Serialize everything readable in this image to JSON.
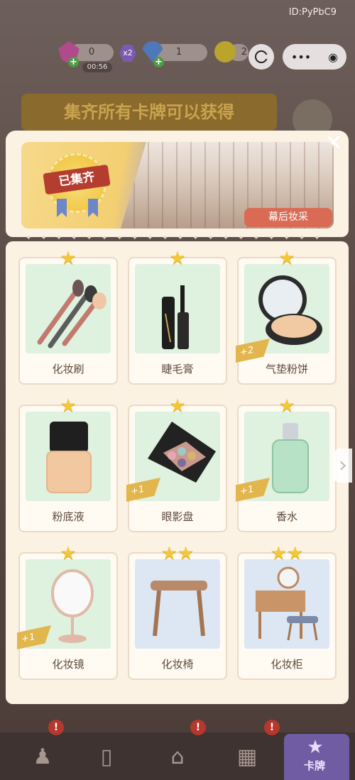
{
  "id_label": "ID:PyPbC9",
  "resources": {
    "energy": "0",
    "energy_timer": "00:56",
    "multiplier": "x2",
    "diamond": "1",
    "coin": "2"
  },
  "capsule": {
    "more": "•••",
    "record": "◉"
  },
  "background_banner": "集齐所有卡牌可以获得",
  "reward": {
    "badge": "已集齐",
    "scene_name": "幕后妆采"
  },
  "close_label": "✕",
  "cards": [
    {
      "name": "化妆刷",
      "stars": "★",
      "bonus": ""
    },
    {
      "name": "睫毛膏",
      "stars": "★",
      "bonus": ""
    },
    {
      "name": "气垫粉饼",
      "stars": "★",
      "bonus": "+2"
    },
    {
      "name": "粉底液",
      "stars": "★",
      "bonus": ""
    },
    {
      "name": "眼影盘",
      "stars": "★",
      "bonus": "+1"
    },
    {
      "name": "香水",
      "stars": "★",
      "bonus": "+1"
    },
    {
      "name": "化妆镜",
      "stars": "★",
      "bonus": "+1"
    },
    {
      "name": "化妆椅",
      "stars": "★★",
      "bonus": ""
    },
    {
      "name": "化妆柜",
      "stars": "★★",
      "bonus": ""
    }
  ],
  "next_arrow": "›",
  "nav": {
    "alert": "!",
    "active_label": "卡牌"
  }
}
